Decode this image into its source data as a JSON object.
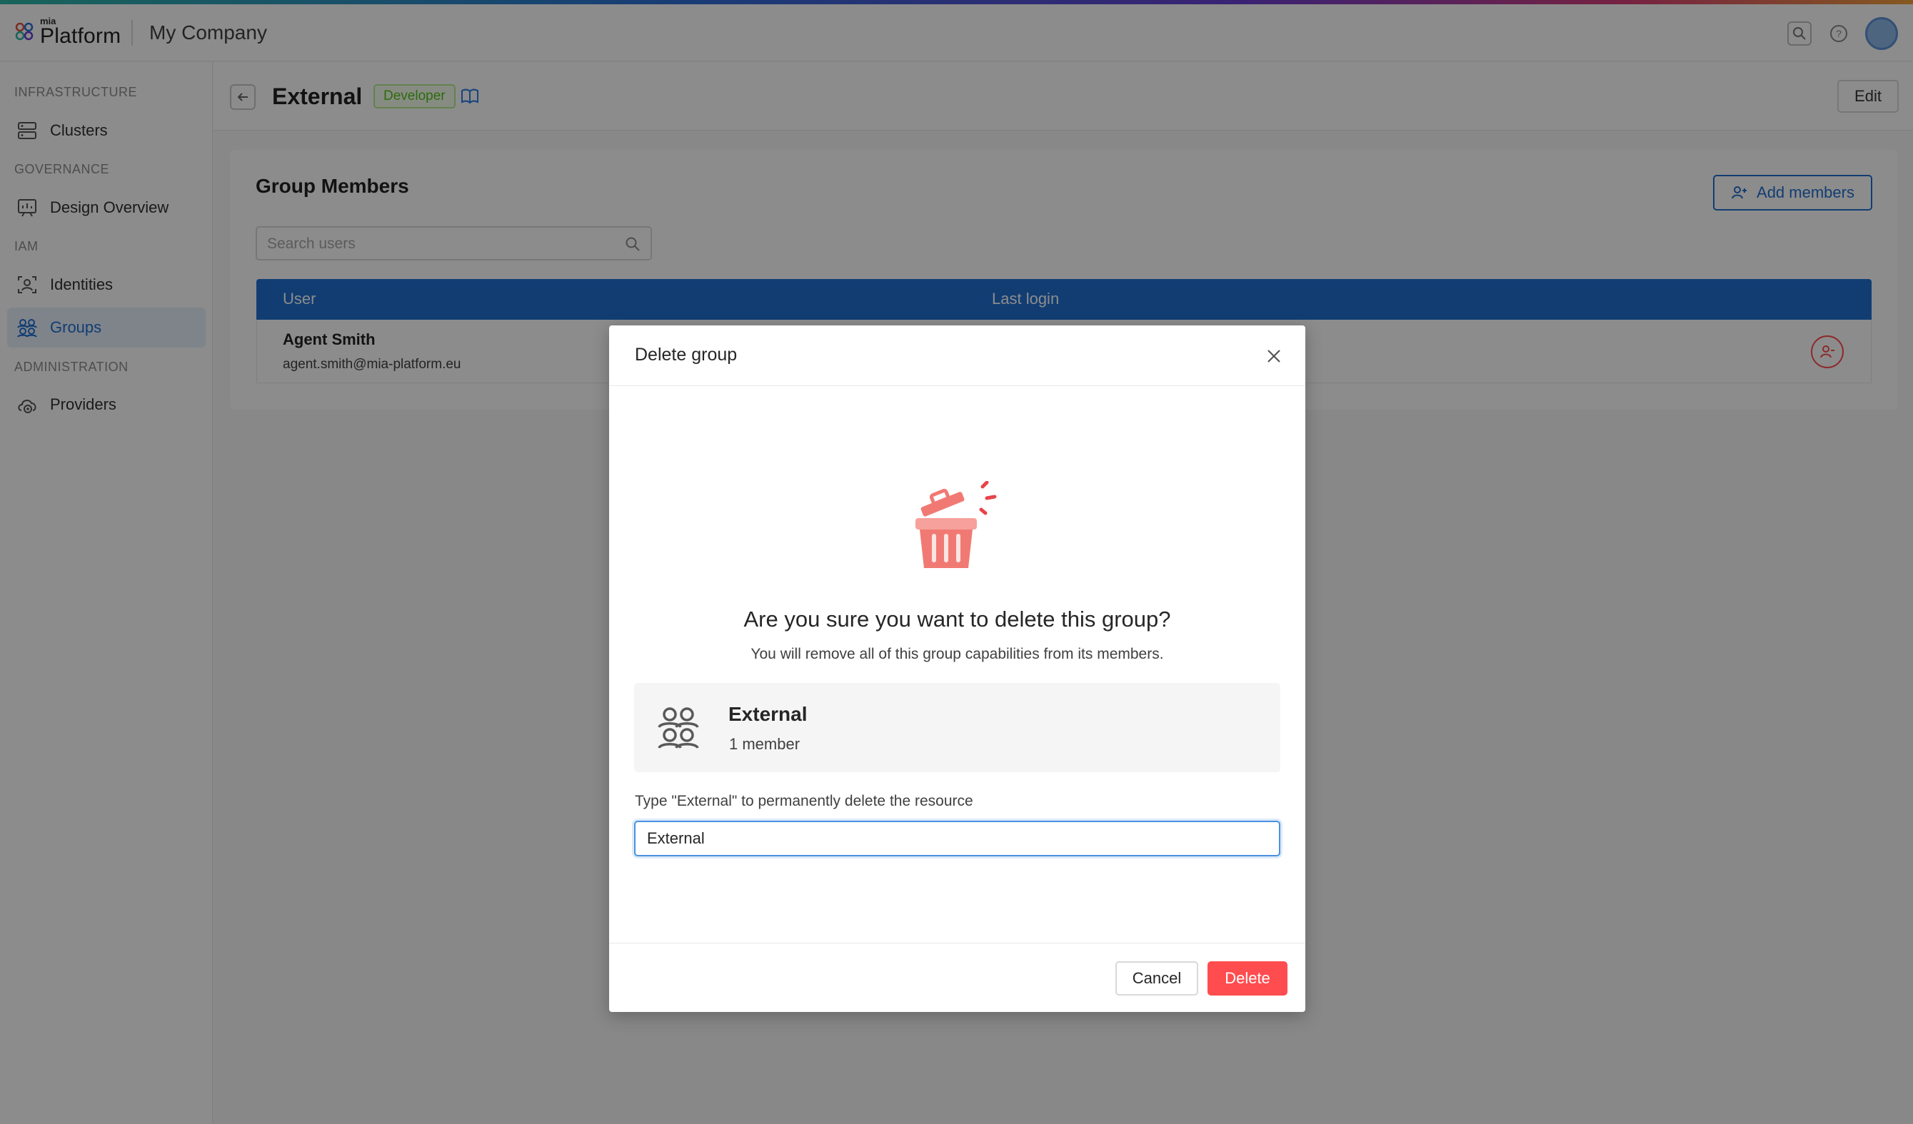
{
  "topbar": {
    "logo_small": "mia",
    "logo_name": "Platform",
    "company": "My Company",
    "icons": [
      "search-icon",
      "help-icon",
      "user-avatar"
    ]
  },
  "sidebar": {
    "sections": [
      {
        "title": "INFRASTRUCTURE",
        "items": [
          {
            "label": "Clusters",
            "icon": "clusters-icon"
          }
        ]
      },
      {
        "title": "GOVERNANCE",
        "items": [
          {
            "label": "Design Overview",
            "icon": "design-overview-icon"
          }
        ]
      },
      {
        "title": "IAM",
        "items": [
          {
            "label": "Identities",
            "icon": "identities-icon"
          },
          {
            "label": "Groups",
            "icon": "groups-icon",
            "active": true
          }
        ]
      },
      {
        "title": "ADMINISTRATION",
        "items": [
          {
            "label": "Providers",
            "icon": "providers-icon"
          }
        ]
      }
    ]
  },
  "header": {
    "title": "External",
    "badge": "Developer",
    "edit_label": "Edit"
  },
  "members": {
    "title": "Group Members",
    "add_label": "Add members",
    "search_placeholder": "Search users",
    "columns": [
      "User",
      "Last login"
    ],
    "rows": [
      {
        "name": "Agent Smith",
        "email": "agent.smith@mia-platform.eu",
        "last_login": ""
      }
    ]
  },
  "modal": {
    "title": "Delete group",
    "heading": "Are you sure you want to delete this group?",
    "description": "You will remove all of this group capabilities from its members.",
    "group_name": "External",
    "group_members": "1 member",
    "type_label": "Type \"External\" to permanently delete the resource",
    "input_value": "External",
    "cancel_label": "Cancel",
    "delete_label": "Delete"
  },
  "colors": {
    "accent": "#1f6fd1",
    "danger": "#ff4d4f",
    "badge_green": "#52c41a"
  }
}
